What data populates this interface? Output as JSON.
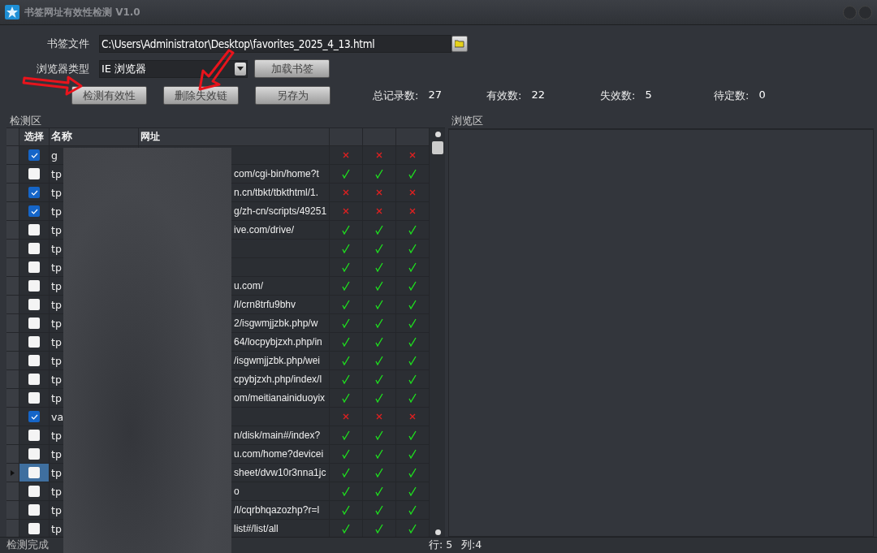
{
  "window": {
    "title": "书签网址有效性检测 V1.0"
  },
  "form": {
    "file_label": "书签文件",
    "file_path": "C:\\Users\\Administrator\\Desktop\\favorites_2025_4_13.html",
    "browser_label": "浏览器类型",
    "browser_value": "IE 浏览器"
  },
  "buttons": {
    "load": "加载书签",
    "check": "检测有效性",
    "delete": "删除失效链",
    "save_as": "另存为"
  },
  "stats": [
    {
      "label": "总记录数:",
      "value": "27"
    },
    {
      "label": "有效数:",
      "value": "22"
    },
    {
      "label": "失效数:",
      "value": "5"
    },
    {
      "label": "待定数:",
      "value": "0"
    }
  ],
  "check_panel": {
    "title": "检测区",
    "columns": [
      "选择",
      "名称",
      "网址"
    ]
  },
  "browse_panel": {
    "title": "浏览区"
  },
  "rows": [
    {
      "checked": true,
      "current": false,
      "name": "g",
      "url": "",
      "checks": [
        false,
        false,
        false
      ]
    },
    {
      "checked": false,
      "current": false,
      "name": "tp",
      "url": "com/cgi-bin/home?t",
      "checks": [
        true,
        true,
        true
      ]
    },
    {
      "checked": true,
      "current": false,
      "name": "tp",
      "url": "n.cn/tbkt/tbkthtml/1.",
      "checks": [
        false,
        false,
        false
      ]
    },
    {
      "checked": true,
      "current": false,
      "name": "tp",
      "url": "g/zh-cn/scripts/49251",
      "checks": [
        false,
        false,
        false
      ]
    },
    {
      "checked": false,
      "current": false,
      "name": "tp",
      "url": "ive.com/drive/",
      "checks": [
        true,
        true,
        true
      ]
    },
    {
      "checked": false,
      "current": false,
      "name": "tp",
      "url": "",
      "checks": [
        true,
        true,
        true
      ]
    },
    {
      "checked": false,
      "current": false,
      "name": "tp",
      "url": "",
      "checks": [
        true,
        true,
        true
      ]
    },
    {
      "checked": false,
      "current": false,
      "name": "tp",
      "url": "u.com/",
      "checks": [
        true,
        true,
        true
      ]
    },
    {
      "checked": false,
      "current": false,
      "name": "tp",
      "url": "/l/crn8trfu9bhv",
      "checks": [
        true,
        true,
        true
      ]
    },
    {
      "checked": false,
      "current": false,
      "name": "tp",
      "url": "2/isgwmjjzbk.php/w",
      "checks": [
        true,
        true,
        true
      ]
    },
    {
      "checked": false,
      "current": false,
      "name": "tp",
      "url": "64/locpybjzxh.php/in",
      "checks": [
        true,
        true,
        true
      ]
    },
    {
      "checked": false,
      "current": false,
      "name": "tp",
      "url": "/isgwmjjzbk.php/wei",
      "checks": [
        true,
        true,
        true
      ]
    },
    {
      "checked": false,
      "current": false,
      "name": "tp",
      "url": "cpybjzxh.php/index/l",
      "checks": [
        true,
        true,
        true
      ]
    },
    {
      "checked": false,
      "current": false,
      "name": "tp",
      "url": "om/meitianainiduoyix",
      "checks": [
        true,
        true,
        true
      ]
    },
    {
      "checked": true,
      "current": false,
      "name": "va",
      "url": "",
      "checks": [
        false,
        false,
        false
      ]
    },
    {
      "checked": false,
      "current": false,
      "name": "tp",
      "url": "n/disk/main#/index?",
      "checks": [
        true,
        true,
        true
      ]
    },
    {
      "checked": false,
      "current": false,
      "name": "tp",
      "url": "u.com/home?devicei",
      "checks": [
        true,
        true,
        true
      ]
    },
    {
      "checked": false,
      "current": true,
      "name": "tp",
      "url": "sheet/dvw10r3nna1jc",
      "checks": [
        true,
        true,
        true
      ]
    },
    {
      "checked": false,
      "current": false,
      "name": "tp",
      "url": "o",
      "checks": [
        true,
        true,
        true
      ]
    },
    {
      "checked": false,
      "current": false,
      "name": "tp",
      "url": "/l/cqrbhqazozhp?r=l",
      "checks": [
        true,
        true,
        true
      ]
    },
    {
      "checked": false,
      "current": false,
      "name": "tp",
      "url": "list#/list/all",
      "checks": [
        true,
        true,
        true
      ]
    }
  ],
  "status_bar": {
    "message": "检测完成",
    "row": "行: 5",
    "column": "列:4"
  }
}
